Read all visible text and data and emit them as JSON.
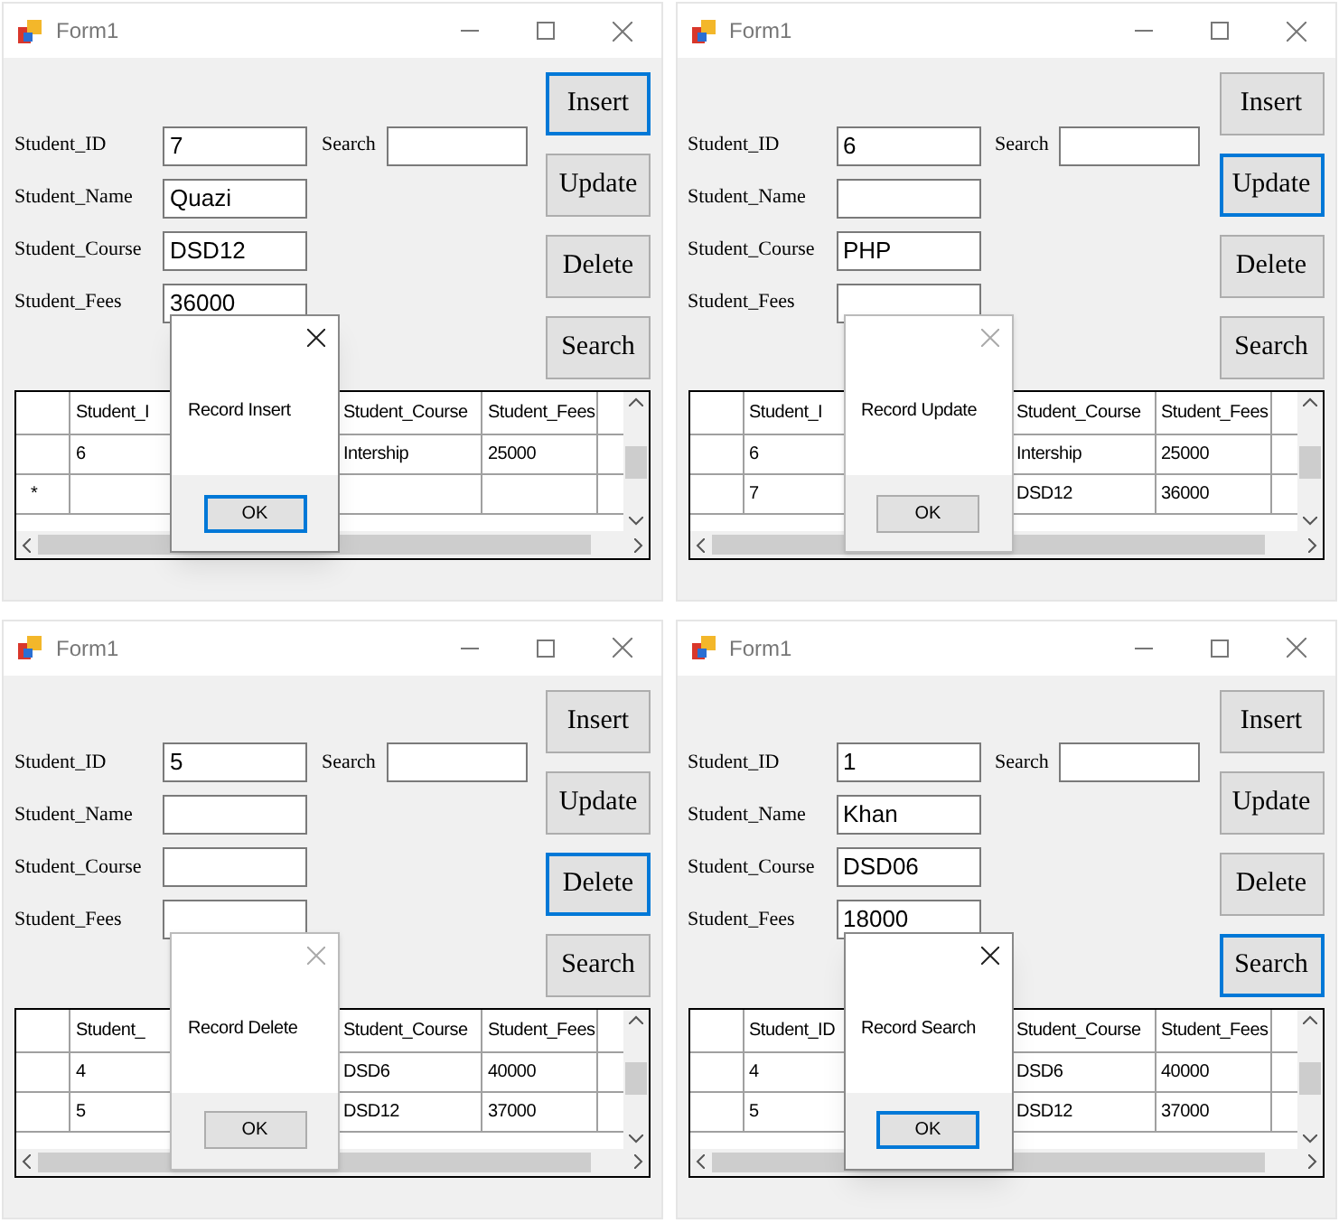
{
  "windows": [
    {
      "title": "Form1",
      "fields": [
        {
          "label": "Student_ID",
          "value": "7"
        },
        {
          "label": "Student_Name",
          "value": "Quazi"
        },
        {
          "label": "Student_Course",
          "value": "DSD12"
        },
        {
          "label": "Student_Fees",
          "value": "36000"
        }
      ],
      "search": {
        "label": "Search"
      },
      "buttons": [
        {
          "label": "Insert",
          "selected": true
        },
        {
          "label": "Update",
          "selected": false
        },
        {
          "label": "Delete",
          "selected": false
        },
        {
          "label": "Search",
          "selected": false
        }
      ],
      "grid": {
        "columns": [
          "Student_I",
          "Student_Course",
          "Student_Fees"
        ],
        "rows": [
          {
            "kind": "data",
            "cells": [
              "6",
              "Intership",
              "25000"
            ]
          },
          {
            "kind": "new",
            "marker": "*"
          }
        ]
      },
      "dialog": {
        "message": "Record Insert",
        "ok": "OK",
        "ok_focused": true,
        "active": true
      }
    },
    {
      "title": "Form1",
      "fields": [
        {
          "label": "Student_ID",
          "value": "6"
        },
        {
          "label": "Student_Name"
        },
        {
          "label": "Student_Course",
          "value": "PHP"
        },
        {
          "label": "Student_Fees"
        }
      ],
      "search": {
        "label": "Search"
      },
      "buttons": [
        {
          "label": "Insert",
          "selected": false
        },
        {
          "label": "Update",
          "selected": true
        },
        {
          "label": "Delete",
          "selected": false
        },
        {
          "label": "Search",
          "selected": false
        }
      ],
      "grid": {
        "columns": [
          "Student_I",
          "Student_Course",
          "Student_Fees"
        ],
        "rows": [
          {
            "kind": "data",
            "cells": [
              "6",
              "Intership",
              "25000"
            ]
          },
          {
            "kind": "data",
            "cells": [
              "7",
              "DSD12",
              "36000"
            ]
          }
        ]
      },
      "dialog": {
        "message": "Record Update",
        "ok": "OK",
        "ok_focused": false,
        "active": false
      }
    },
    {
      "title": "Form1",
      "fields": [
        {
          "label": "Student_ID",
          "value": "5"
        },
        {
          "label": "Student_Name"
        },
        {
          "label": "Student_Course"
        },
        {
          "label": "Student_Fees"
        }
      ],
      "search": {
        "label": "Search"
      },
      "buttons": [
        {
          "label": "Insert",
          "selected": false
        },
        {
          "label": "Update",
          "selected": false
        },
        {
          "label": "Delete",
          "selected": true
        },
        {
          "label": "Search",
          "selected": false
        }
      ],
      "grid": {
        "columns": [
          "Student_",
          "Student_Course",
          "Student_Fees"
        ],
        "rows": [
          {
            "kind": "data",
            "cells": [
              "4",
              "DSD6",
              "40000"
            ]
          },
          {
            "kind": "data",
            "cells": [
              "5",
              "DSD12",
              "37000"
            ]
          }
        ]
      },
      "dialog": {
        "message": "Record Delete",
        "ok": "OK",
        "ok_focused": false,
        "active": false
      }
    },
    {
      "title": "Form1",
      "fields": [
        {
          "label": "Student_ID",
          "value": "1"
        },
        {
          "label": "Student_Name",
          "value": "Khan"
        },
        {
          "label": "Student_Course",
          "value": "DSD06"
        },
        {
          "label": "Student_Fees",
          "value": "18000"
        }
      ],
      "search": {
        "label": "Search"
      },
      "buttons": [
        {
          "label": "Insert",
          "selected": false
        },
        {
          "label": "Update",
          "selected": false
        },
        {
          "label": "Delete",
          "selected": false
        },
        {
          "label": "Search",
          "selected": true
        }
      ],
      "grid": {
        "columns": [
          "Student_ID",
          "Student_Course",
          "Student_Fees"
        ],
        "rows": [
          {
            "kind": "data",
            "cells": [
              "4",
              "DSD6",
              "40000"
            ]
          },
          {
            "kind": "data",
            "cells": [
              "5",
              "DSD12",
              "37000"
            ]
          }
        ]
      },
      "dialog": {
        "message": "Record Search",
        "ok": "OK",
        "ok_focused": true,
        "active": true
      }
    }
  ]
}
